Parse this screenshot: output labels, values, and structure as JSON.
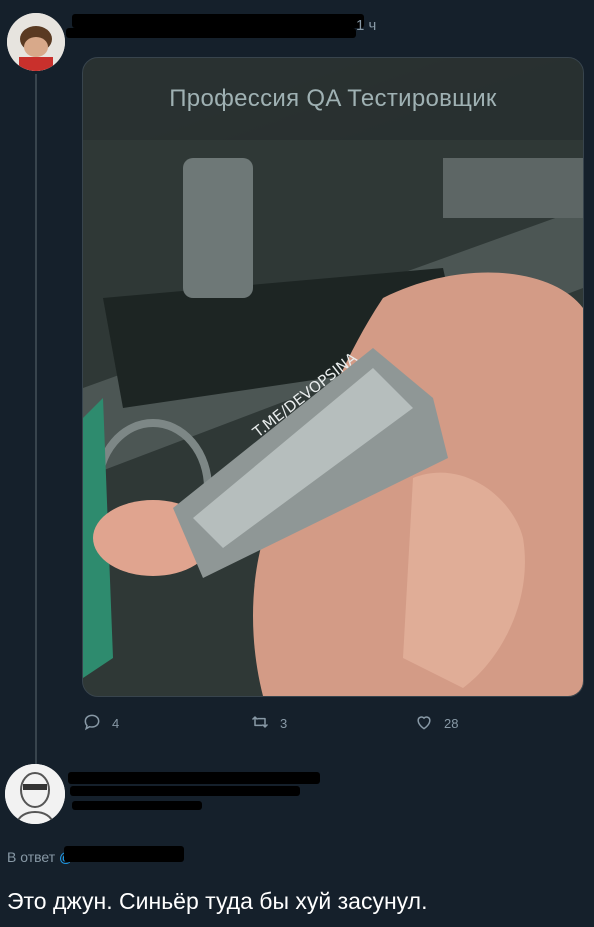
{
  "tweet": {
    "time": "1 ч",
    "media_caption": "Профессия QA Тестировщик",
    "media_watermark": "T.ME/DEVOPSINA",
    "replies_count": "4",
    "retweets_count": "3",
    "likes_count": "28"
  },
  "reply": {
    "reply_to_label": "В ответ",
    "reply_to_handle": "@",
    "text": "Это джун. Синьёр туда бы хуй засунул."
  },
  "icons": {
    "reply": "reply-icon",
    "retweet": "retweet-icon",
    "like": "heart-icon"
  }
}
